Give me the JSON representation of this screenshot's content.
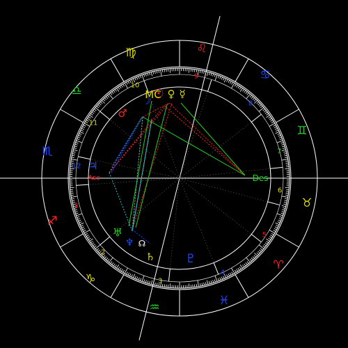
{
  "chart": {
    "signs": [
      {
        "name": "Virgo",
        "symbol": "♍",
        "color": "#d8d800",
        "lon": 162
      },
      {
        "name": "Leo",
        "symbol": "♌",
        "color": "#ff2020",
        "lon": 132
      },
      {
        "name": "Cancer",
        "symbol": "♋",
        "color": "#1e4bff",
        "lon": 102
      },
      {
        "name": "Gemini",
        "symbol": "♊",
        "color": "#20d020",
        "lon": 72
      },
      {
        "name": "Taurus",
        "symbol": "♉",
        "color": "#d8d800",
        "lon": 42
      },
      {
        "name": "Aries",
        "symbol": "♈",
        "color": "#ff2020",
        "lon": 12
      },
      {
        "name": "Pisces",
        "symbol": "♓",
        "color": "#1e4bff",
        "lon": 342
      },
      {
        "name": "Aquarius",
        "symbol": "♒",
        "color": "#20d020",
        "lon": 312
      },
      {
        "name": "Capricorn",
        "symbol": "♑",
        "color": "#d8d800",
        "lon": 282
      },
      {
        "name": "Sagittarius",
        "symbol": "♐",
        "color": "#ff2020",
        "lon": 252
      },
      {
        "name": "Scorpio",
        "symbol": "♏",
        "color": "#1e4bff",
        "lon": 222
      },
      {
        "name": "Libra",
        "symbol": "♎",
        "color": "#20d020",
        "lon": 192
      }
    ],
    "houses": [
      {
        "num": "1",
        "lon": 195
      },
      {
        "num": "2",
        "lon": 218
      },
      {
        "num": "3",
        "lon": 248
      },
      {
        "num": "4",
        "lon": 276
      },
      {
        "num": "5",
        "lon": 320
      },
      {
        "num": "6",
        "lon": 356
      },
      {
        "num": "7",
        "lon": 12
      },
      {
        "num": "8",
        "lon": 40
      },
      {
        "num": "9",
        "lon": 70
      },
      {
        "num": "10",
        "lon": 108
      },
      {
        "num": "11",
        "lon": 142
      },
      {
        "num": "12",
        "lon": 174
      }
    ],
    "angles": {
      "asc": {
        "label": "Asc",
        "color": "#ff2020"
      },
      "des": {
        "label": "Des",
        "color": "#20d020"
      },
      "mc": {
        "label": "MC",
        "color": "#d8d800"
      }
    },
    "planets": [
      {
        "name": "Moon",
        "symbol": "☽",
        "color": "#1e4bff"
      },
      {
        "name": "Mars",
        "symbol": "♂",
        "color": "#ff2020"
      },
      {
        "name": "Venus",
        "symbol": "♀",
        "color": "#d8d800"
      },
      {
        "name": "Sun",
        "symbol": "☉",
        "color": "#ff2020"
      },
      {
        "name": "Mercury",
        "symbol": "☿",
        "color": "#d8d800"
      },
      {
        "name": "Neptune",
        "symbol": "♆",
        "color": "#1e4bff"
      },
      {
        "name": "Uranus",
        "symbol": "♅",
        "color": "#20d020"
      },
      {
        "name": "Jupiter",
        "symbol": "♃",
        "color": "#1e4bff"
      },
      {
        "name": "Saturn",
        "symbol": "♄",
        "color": "#d8d800"
      },
      {
        "name": "Pluto",
        "symbol": "♇",
        "color": "#1e4bff"
      },
      {
        "name": "North Node",
        "symbol": "☊",
        "color": "#ffffff"
      }
    ],
    "colors": {
      "background": "#000000",
      "line": "#ffffff",
      "red": "#ff2020",
      "green": "#20d020",
      "blue": "#1e4bff",
      "yellow": "#d8d800",
      "cyan": "#20c8c8"
    }
  }
}
